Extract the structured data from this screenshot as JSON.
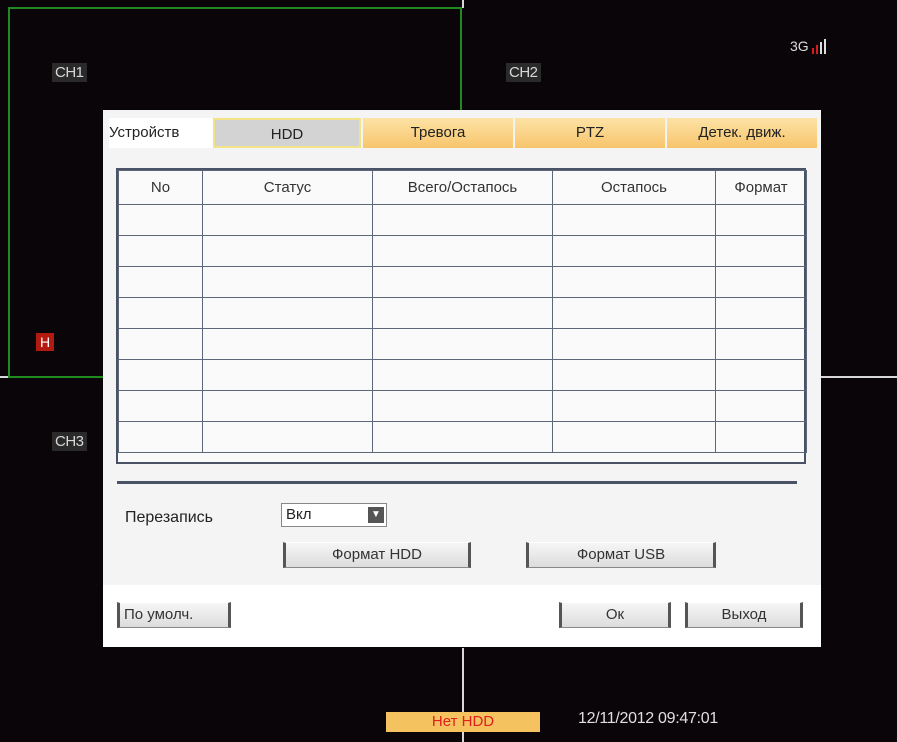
{
  "channels": {
    "ch1": "CH1",
    "ch2": "CH2",
    "ch3": "CH3"
  },
  "h_badge": "H",
  "signal": {
    "network": "3G",
    "icon": "signal-bars-icon"
  },
  "dialog": {
    "tabs": {
      "device": "Устройств",
      "hdd": "HDD",
      "alarm": "Тревога",
      "ptz": "PTZ",
      "motion": "Детек. движ."
    },
    "table": {
      "headers": [
        "No",
        "Статус",
        "Всего/Остапось",
        "Остапось",
        "Формат"
      ],
      "rows": [
        [
          "",
          "",
          "",
          "",
          ""
        ],
        [
          "",
          "",
          "",
          "",
          ""
        ],
        [
          "",
          "",
          "",
          "",
          ""
        ],
        [
          "",
          "",
          "",
          "",
          ""
        ],
        [
          "",
          "",
          "",
          "",
          ""
        ],
        [
          "",
          "",
          "",
          "",
          ""
        ],
        [
          "",
          "",
          "",
          "",
          ""
        ],
        [
          "",
          "",
          "",
          "",
          ""
        ]
      ]
    },
    "overwrite_label": "Перезапись",
    "overwrite_value": "Вкл",
    "format_hdd": "Формат HDD",
    "format_usb": "Формат USB",
    "default_button": "По умолч.",
    "ok_button": "Ок",
    "exit_button": "Выход"
  },
  "status": {
    "hdd": "Нет HDD",
    "datetime": "12/11/2012 09:47:01"
  },
  "colors": {
    "grid_green": "#1f8a1f",
    "tab_orange": "#f7c56b",
    "status_bg": "#f4c25e",
    "status_text": "#e02020",
    "table_border": "#4a5366"
  }
}
